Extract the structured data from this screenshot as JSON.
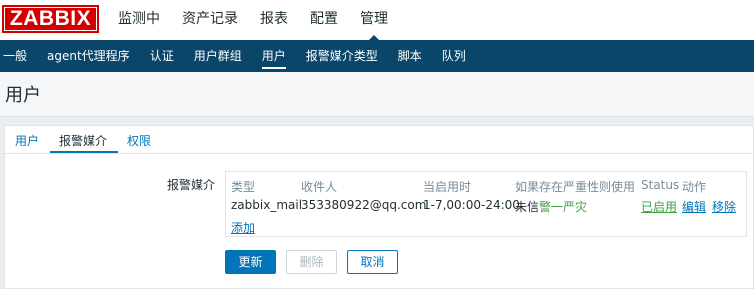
{
  "brand": {
    "logo_text": "ZABBIX",
    "color": "#d40000"
  },
  "main_nav": [
    {
      "label": "监测中",
      "active": false
    },
    {
      "label": "资产记录",
      "active": false
    },
    {
      "label": "报表",
      "active": false
    },
    {
      "label": "配置",
      "active": false
    },
    {
      "label": "管理",
      "active": true
    }
  ],
  "sub_nav": [
    {
      "label": "一般",
      "active": false
    },
    {
      "label": "agent代理程序",
      "active": false
    },
    {
      "label": "认证",
      "active": false
    },
    {
      "label": "用户群组",
      "active": false
    },
    {
      "label": "用户",
      "active": true
    },
    {
      "label": "报警媒介类型",
      "active": false
    },
    {
      "label": "脚本",
      "active": false
    },
    {
      "label": "队列",
      "active": false
    }
  ],
  "page": {
    "title": "用户"
  },
  "tabs": [
    {
      "label": "用户",
      "active": false
    },
    {
      "label": "报警媒介",
      "active": true
    },
    {
      "label": "权限",
      "active": false
    }
  ],
  "media": {
    "label": "报警媒介",
    "columns": {
      "type": "类型",
      "send_to": "收件人",
      "when_active": "当启用时",
      "use_if_severity": "如果存在严重性则使用",
      "status": "Status",
      "action": "动作"
    },
    "row": {
      "type": "zabbix_mail",
      "send_to": "353380922@qq.com",
      "when_active": "1-7,00:00-24:00",
      "severity_left": "未信",
      "severity_right": "警一严灾",
      "status": "已启用",
      "edit": "编辑",
      "remove": "移除"
    },
    "add_link": "添加"
  },
  "buttons": {
    "update": "更新",
    "delete": "删除",
    "cancel": "取消"
  },
  "colors": {
    "accent": "#0275b8",
    "navy": "#0a466a",
    "enabled": "#429e47"
  }
}
